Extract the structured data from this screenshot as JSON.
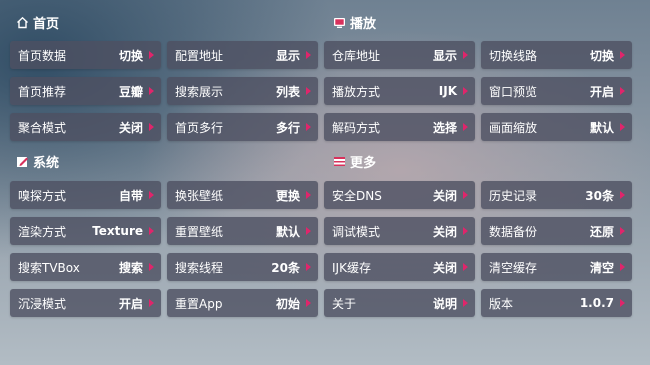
{
  "sections": {
    "home": {
      "title": "首页",
      "icon": "home-icon"
    },
    "playback": {
      "title": "播放",
      "icon": "tv-icon"
    },
    "system": {
      "title": "系统",
      "icon": "edit-icon"
    },
    "more": {
      "title": "更多",
      "icon": "flag-icon"
    }
  },
  "accent_color": "#e0256b",
  "items": [
    {
      "id": "home-data",
      "label": "首页数据",
      "value": "切换"
    },
    {
      "id": "config-address",
      "label": "配置地址",
      "value": "显示"
    },
    {
      "id": "repo-address",
      "label": "仓库地址",
      "value": "显示"
    },
    {
      "id": "switch-line",
      "label": "切换线路",
      "value": "切换"
    },
    {
      "id": "home-recommend",
      "label": "首页推荐",
      "value": "豆瓣"
    },
    {
      "id": "search-display",
      "label": "搜索展示",
      "value": "列表"
    },
    {
      "id": "play-method",
      "label": "播放方式",
      "value": "IJK"
    },
    {
      "id": "window-preview",
      "label": "窗口预览",
      "value": "开启"
    },
    {
      "id": "aggregate-mode",
      "label": "聚合模式",
      "value": "关闭"
    },
    {
      "id": "home-multirow",
      "label": "首页多行",
      "value": "多行"
    },
    {
      "id": "decode-method",
      "label": "解码方式",
      "value": "选择"
    },
    {
      "id": "screen-scale",
      "label": "画面缩放",
      "value": "默认"
    },
    {
      "id": "sniff-method",
      "label": "嗅探方式",
      "value": "自带"
    },
    {
      "id": "change-wallpaper",
      "label": "换张壁纸",
      "value": "更换"
    },
    {
      "id": "safe-dns",
      "label": "安全DNS",
      "value": "关闭"
    },
    {
      "id": "history",
      "label": "历史记录",
      "value": "30条"
    },
    {
      "id": "render-method",
      "label": "渲染方式",
      "value": "Texture"
    },
    {
      "id": "reset-wallpaper",
      "label": "重置壁纸",
      "value": "默认"
    },
    {
      "id": "debug-mode",
      "label": "调试模式",
      "value": "关闭"
    },
    {
      "id": "data-backup",
      "label": "数据备份",
      "value": "还原"
    },
    {
      "id": "search-tvbox",
      "label": "搜索TVBox",
      "value": "搜索"
    },
    {
      "id": "search-threads",
      "label": "搜索线程",
      "value": "20条"
    },
    {
      "id": "ijk-cache",
      "label": "IJK缓存",
      "value": "关闭"
    },
    {
      "id": "clear-cache",
      "label": "清空缓存",
      "value": "清空"
    },
    {
      "id": "immersive-mode",
      "label": "沉浸模式",
      "value": "开启"
    },
    {
      "id": "reset-app",
      "label": "重置App",
      "value": "初始"
    },
    {
      "id": "about",
      "label": "关于",
      "value": "说明"
    },
    {
      "id": "version",
      "label": "版本",
      "value": "1.0.7"
    }
  ]
}
